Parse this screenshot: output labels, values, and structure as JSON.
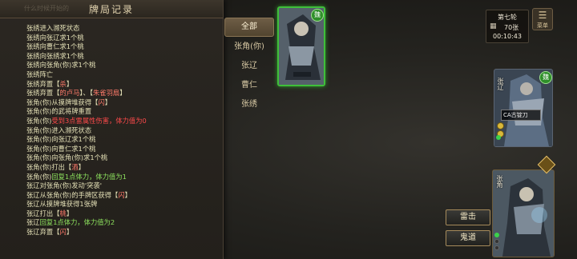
{
  "log": {
    "ghost_text": "什么时候开始的",
    "title": "牌局记录",
    "lines": [
      [
        {
          "t": "张绣进入濒死状态",
          "c": "ln"
        }
      ],
      [
        {
          "t": "张绣向张辽求1个桃",
          "c": "ln"
        }
      ],
      [
        {
          "t": "张绣向曹仁求1个桃",
          "c": "ln"
        }
      ],
      [
        {
          "t": "张绣向张绣求1个桃",
          "c": "ln"
        }
      ],
      [
        {
          "t": "张绣向张角(你)求1个桃",
          "c": "ln"
        }
      ],
      [
        {
          "t": "张绣阵亡",
          "c": "ln"
        }
      ],
      [
        {
          "t": "张绣弃置【",
          "c": "ln"
        },
        {
          "t": "杀",
          "c": "hl"
        },
        {
          "t": "】",
          "c": "ln"
        }
      ],
      [
        {
          "t": "张绣弃置【",
          "c": "ln"
        },
        {
          "t": "的卢马",
          "c": "hl"
        },
        {
          "t": "】、【",
          "c": "ln"
        },
        {
          "t": "朱雀羽扇",
          "c": "hl"
        },
        {
          "t": "】",
          "c": "ln"
        }
      ],
      [
        {
          "t": "张角(你)从摸牌堆获得【",
          "c": "ln"
        },
        {
          "t": "闪",
          "c": "hl"
        },
        {
          "t": "】",
          "c": "ln"
        }
      ],
      [
        {
          "t": "张角(你)的武将牌重置",
          "c": "ln"
        }
      ],
      [
        {
          "t": "张角(你)",
          "c": "ln"
        },
        {
          "t": "受到3点雷属性伤害，体力值为0",
          "c": "red"
        }
      ],
      [
        {
          "t": "张角(你)进入濒死状态",
          "c": "ln"
        }
      ],
      [
        {
          "t": "张角(你)向张辽求1个桃",
          "c": "ln"
        }
      ],
      [
        {
          "t": "张角(你)向曹仁求1个桃",
          "c": "ln"
        }
      ],
      [
        {
          "t": "张角(你)向张角(你)求1个桃",
          "c": "ln"
        }
      ],
      [
        {
          "t": "张角(你)打出【",
          "c": "ln"
        },
        {
          "t": "酒",
          "c": "hl"
        },
        {
          "t": "】",
          "c": "ln"
        }
      ],
      [
        {
          "t": "张角(你)",
          "c": "ln"
        },
        {
          "t": "回复1点体力，体力值为1",
          "c": "green"
        }
      ],
      [
        {
          "t": "张辽对张角(你)发动'突袭'",
          "c": "ln"
        }
      ],
      [
        {
          "t": "张辽从张角(你)的手牌区获得【",
          "c": "ln"
        },
        {
          "t": "闪",
          "c": "hl"
        },
        {
          "t": "】",
          "c": "ln"
        }
      ],
      [
        {
          "t": "张辽从摸牌堆获得1张牌",
          "c": "ln"
        }
      ],
      [
        {
          "t": "张辽打出【",
          "c": "ln"
        },
        {
          "t": "桃",
          "c": "hl"
        },
        {
          "t": "】",
          "c": "ln"
        }
      ],
      [
        {
          "t": "张辽",
          "c": "ln"
        },
        {
          "t": "回复1点体力，体力值为2",
          "c": "green"
        }
      ],
      [
        {
          "t": "张辽弃置【",
          "c": "ln"
        },
        {
          "t": "闪",
          "c": "hl"
        },
        {
          "t": "】",
          "c": "ln"
        }
      ]
    ]
  },
  "filters": {
    "tabs": [
      {
        "label": "全部",
        "active": true
      },
      {
        "label": "张角(你)",
        "active": false
      },
      {
        "label": "张辽",
        "active": false
      },
      {
        "label": "曹仁",
        "active": false
      },
      {
        "label": "张绣",
        "active": false
      }
    ]
  },
  "players": {
    "top": {
      "faction_badge": "魏",
      "badge_color": "#2f8f2a"
    },
    "right": {
      "name": "张辽",
      "tag": "CA古锭刀",
      "faction_badge": "魏"
    },
    "self": {
      "name": "张角"
    }
  },
  "round": {
    "label": "第七轮",
    "deck_count": "70张",
    "timer": "00:10:43"
  },
  "menu": {
    "label": "菜单"
  },
  "skills": {
    "leiji": "雷击",
    "guidao": "鬼道"
  },
  "icons": {
    "menu": "menu-icon",
    "deck": "deck-icon"
  }
}
